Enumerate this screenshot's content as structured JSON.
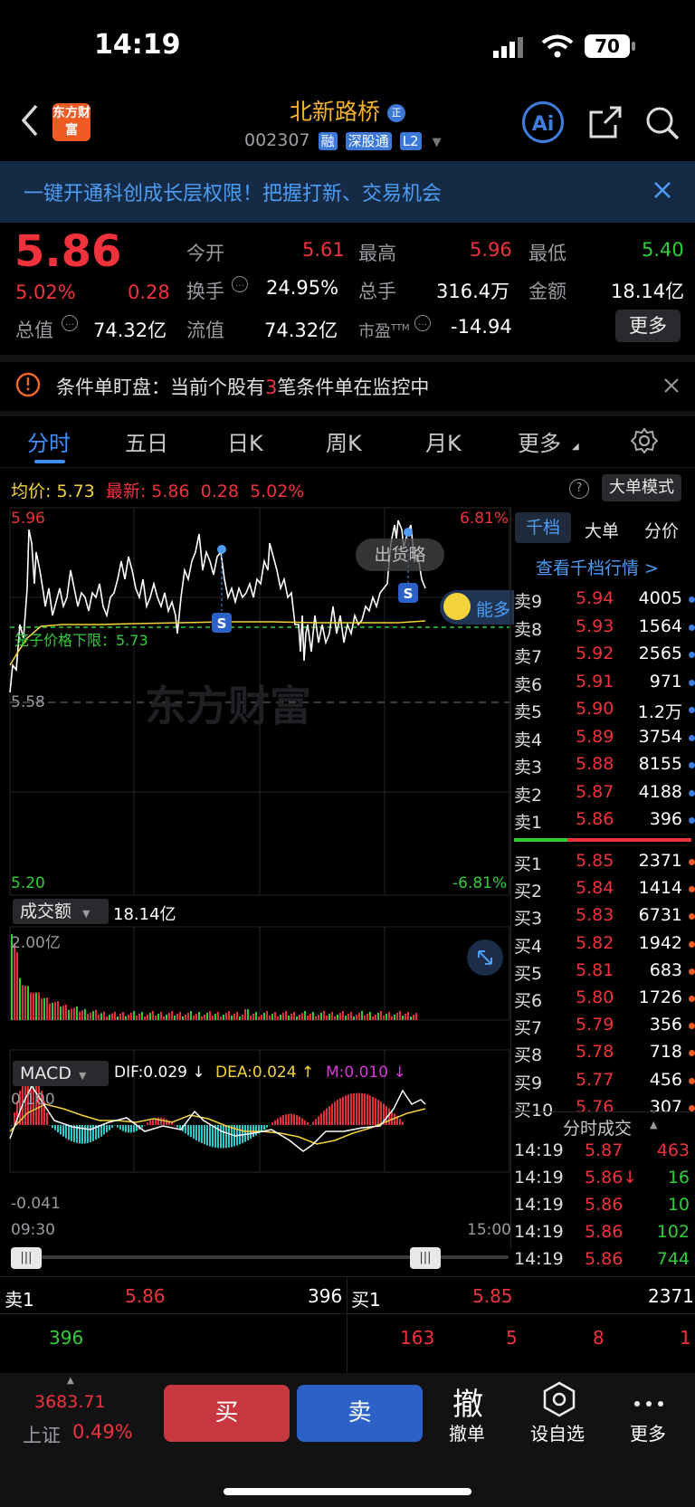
{
  "status_bar": {
    "time": "14:19",
    "battery": "70"
  },
  "header": {
    "logo_text": "东方财富",
    "stock_name": "北新路桥",
    "name_badge": "正",
    "code": "002307",
    "badges": [
      "融",
      "深股通",
      "L2"
    ],
    "ai_label": "Ai"
  },
  "banner": {
    "text": "一键开通科创成长层权限！把握打新、交易机会"
  },
  "quote": {
    "price": "5.86",
    "pct": "5.02%",
    "change": "0.28",
    "today_open_label": "今开",
    "today_open": "5.61",
    "high_label": "最高",
    "high": "5.96",
    "low_label": "最低",
    "low": "5.40",
    "turnover_label": "换手",
    "turnover": "24.95%",
    "volume_label": "总手",
    "volume": "316.4万",
    "amount_label": "金额",
    "amount": "18.14亿",
    "mkt_cap_label": "总值",
    "mkt_cap": "74.32亿",
    "float_cap_label": "流值",
    "float_cap": "74.32亿",
    "pe_label": "市盈",
    "pe_sup": "TTM",
    "pe": "-14.94",
    "more_label": "更多"
  },
  "alert": {
    "prefix": "条件单盯盘：当前个股有",
    "count": "3",
    "suffix": "笔条件单在监控中"
  },
  "tabs": [
    "分时",
    "五日",
    "日K",
    "周K",
    "月K",
    "更多"
  ],
  "chart_header": {
    "avg_label": "均价:",
    "avg": "5.73",
    "latest_label": "最新:",
    "latest": "5.86",
    "latest_change": "0.28",
    "latest_pct": "5.02%",
    "big_order_label": "大单模式"
  },
  "chart_labels": {
    "top_price": "5.96",
    "top_pct": "6.81%",
    "bottom_price": "5.20",
    "bottom_pct": "-6.81%",
    "mid_price": "5.58",
    "limit_text": "笼子价格下限：5.73",
    "popup": "出货略",
    "neng_label": "能多",
    "watermark": "东方财富",
    "marker_s": "S"
  },
  "volume_panel": {
    "label": "成交额",
    "value": "18.14亿",
    "max": "2.00亿"
  },
  "macd_panel": {
    "label": "MACD",
    "dif": "DIF:0.029 ↓",
    "dea": "DEA:0.024 ↑",
    "m": "M:0.010 ↓",
    "max": "0.100",
    "min": "-0.041"
  },
  "time_axis": {
    "start": "09:30",
    "end": "15:00"
  },
  "side_tabs": [
    "千档",
    "大单",
    "分价"
  ],
  "side_link": "查看千档行情 >",
  "order_book": {
    "asks": [
      {
        "label": "卖9",
        "price": "5.94",
        "vol": "4005"
      },
      {
        "label": "卖8",
        "price": "5.93",
        "vol": "1564"
      },
      {
        "label": "卖7",
        "price": "5.92",
        "vol": "2565"
      },
      {
        "label": "卖6",
        "price": "5.91",
        "vol": "971"
      },
      {
        "label": "卖5",
        "price": "5.90",
        "vol": "1.2万"
      },
      {
        "label": "卖4",
        "price": "5.89",
        "vol": "3754"
      },
      {
        "label": "卖3",
        "price": "5.88",
        "vol": "8155"
      },
      {
        "label": "卖2",
        "price": "5.87",
        "vol": "4188"
      },
      {
        "label": "卖1",
        "price": "5.86",
        "vol": "396"
      }
    ],
    "bids": [
      {
        "label": "买1",
        "price": "5.85",
        "vol": "2371"
      },
      {
        "label": "买2",
        "price": "5.84",
        "vol": "1414"
      },
      {
        "label": "买3",
        "price": "5.83",
        "vol": "6731"
      },
      {
        "label": "买4",
        "price": "5.82",
        "vol": "1942"
      },
      {
        "label": "买5",
        "price": "5.81",
        "vol": "683"
      },
      {
        "label": "买6",
        "price": "5.80",
        "vol": "1726"
      },
      {
        "label": "买7",
        "price": "5.79",
        "vol": "356"
      },
      {
        "label": "买8",
        "price": "5.78",
        "vol": "718"
      },
      {
        "label": "买9",
        "price": "5.77",
        "vol": "456"
      },
      {
        "label": "买10",
        "price": "5.76",
        "vol": "307"
      }
    ]
  },
  "ticks_title": "分时成交",
  "ticks": [
    {
      "time": "14:19",
      "price": "5.87",
      "vol": "463"
    },
    {
      "time": "14:19",
      "price": "5.86↓",
      "vol": "16"
    },
    {
      "time": "14:19",
      "price": "5.86",
      "vol": "10"
    },
    {
      "time": "14:19",
      "price": "5.86",
      "vol": "102"
    },
    {
      "time": "14:19",
      "price": "5.86",
      "vol": "744"
    }
  ],
  "queue": {
    "sell_label": "卖1",
    "sell_price": "5.86",
    "sell_vol": "396",
    "sell_queue": [
      "396"
    ],
    "buy_label": "买1",
    "buy_price": "5.85",
    "buy_vol": "2371",
    "buy_queue": [
      "163",
      "5",
      "8",
      "1"
    ]
  },
  "bottom": {
    "index_value": "3683.71",
    "index_name": "上证",
    "index_pct": "0.49%",
    "buy": "买",
    "sell": "卖",
    "cancel_icon": "撤",
    "cancel": "撤单",
    "watch": "设自选",
    "more": "更多"
  }
}
